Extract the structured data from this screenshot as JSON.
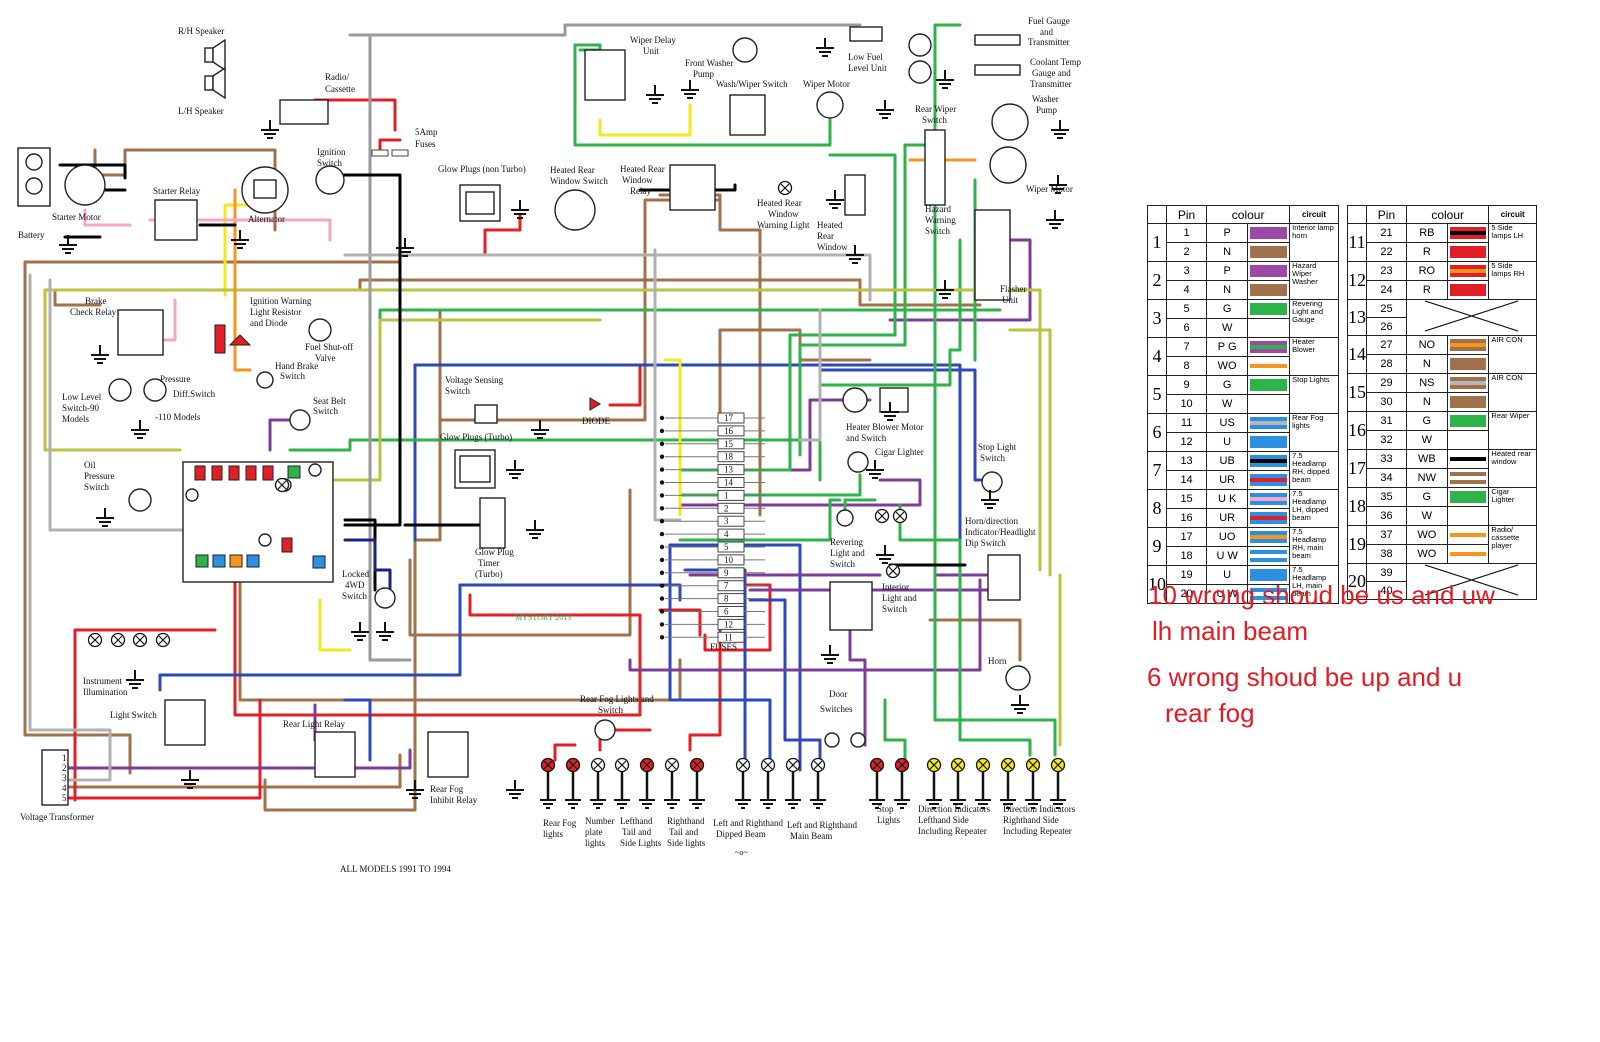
{
  "diagram": {
    "footer": "ALL MODELS 1991 TO 1994",
    "watermark": "MYSTORY 2013",
    "labels": {
      "rh_speaker": "R/H Speaker",
      "lh_speaker": "L/H Speaker",
      "radio": [
        "Radio/",
        "Cassette"
      ],
      "fuses_5a": [
        "5Amp",
        "Fuses"
      ],
      "battery": "Battery",
      "starter_motor": "Starter Motor",
      "starter_relay": "Starter Relay",
      "alternator": "Alternator",
      "ignition_switch": [
        "Ignition",
        "Switch"
      ],
      "glow_plugs_non_turbo": "Glow Plugs (non Turbo)",
      "heated_rear_window_switch": [
        "Heated Rear",
        "Window Switch"
      ],
      "heated_rear_window_relay": [
        "Heated Rear",
        "Window",
        "Relay"
      ],
      "heated_rear_window_warning": [
        "Heated Rear",
        "Window",
        "Warning Light"
      ],
      "heated_rear_window": [
        "Heated",
        "Rear",
        "Window"
      ],
      "wiper_delay_unit": [
        "Wiper Delay",
        "Unit"
      ],
      "front_washer_pump": [
        "Front Washer",
        "Pump"
      ],
      "wash_wiper_switch": "Wash/Wiper Switch",
      "wiper_motor_front": "Wiper Motor",
      "low_fuel_level_unit": [
        "Low Fuel",
        "Level Unit"
      ],
      "fuel_gauge": [
        "Fuel Gauge",
        "and",
        "Transmitter"
      ],
      "coolant_temp": [
        "Coolant Temp",
        "Gauge and",
        "Transmitter"
      ],
      "rear_wiper_switch": [
        "Rear Wiper",
        "Switch"
      ],
      "washer_pump": [
        "Washer",
        "Pump"
      ],
      "wiper_motor_rear": "Wiper Motor",
      "hazard_warning_switch": [
        "Hazard",
        "Warning",
        "Switch"
      ],
      "flasher_unit": [
        "Flasher",
        "Unit"
      ],
      "brake_check_relay": [
        "Brake",
        "Check Relay"
      ],
      "ignition_warning": [
        "Ignition Warning",
        "Light Resistor",
        "and Diode"
      ],
      "fuel_shutoff": [
        "Fuel Shut-off",
        "Valve"
      ],
      "hand_brake_switch": [
        "Hand Brake",
        "Switch"
      ],
      "seat_belt_switch": [
        "Seat Belt",
        "Switch"
      ],
      "low_level_switch": [
        "Low Level",
        "Switch-90",
        "Models"
      ],
      "pressure_diff_switch": [
        "Pressure",
        "Diff.Switch",
        "-110  Models"
      ],
      "oil_pressure_switch": [
        "Oil",
        "Pressure",
        "Switch"
      ],
      "voltage_sensing_switch": [
        "Voltage Sensing",
        "Switch"
      ],
      "diode": "DIODE",
      "glow_plugs_turbo": "Glow Plugs (Turbo)",
      "glow_plug_timer": [
        "Glow Plug",
        "Timer",
        "(Turbo)"
      ],
      "locked_4wd_switch": [
        "Locked",
        "4WD",
        "Switch"
      ],
      "heater_blower": [
        "Heater Blower Motor",
        "and Switch"
      ],
      "cigar_lighter": "Cigar Lighter",
      "stop_light_switch": [
        "Stop Light",
        "Switch"
      ],
      "horn_dip_switch": [
        "Horn/direction",
        "Indicator/Headlight",
        "Dip Switch"
      ],
      "reversing_light_switch": [
        "Revering",
        "Light and",
        "Switch"
      ],
      "interior_light": [
        "Interior",
        "Light and",
        "Switch"
      ],
      "horn": "Horn",
      "door_switches": [
        "Door",
        "Switches"
      ],
      "instrument_illumination": [
        "Instrument",
        "Illumination"
      ],
      "light_switch": "Light Switch",
      "rear_light_relay": "Rear Light Relay",
      "rear_fog_switch": [
        "Rear Fog Lights and",
        "Switch"
      ],
      "rear_fog_inhibit_relay": [
        "Rear Fog",
        "Inhibit Relay"
      ],
      "voltage_transformer": "Voltage Transformer",
      "fuses": "FUSES",
      "rear_fog_lights": [
        "Rear Fog",
        "lights"
      ],
      "number_plate_lights": [
        "Number",
        "plate",
        "lights"
      ],
      "lh_tail_side": [
        "Lefthand",
        "Tail and",
        "Side Lights"
      ],
      "rh_tail_side": [
        "Righthand",
        "Tail and",
        "Side lights"
      ],
      "dipped_beam": [
        "Left and Righthand",
        "Dipped Beam"
      ],
      "main_beam": [
        "Left and Righthand",
        "Main Beam"
      ],
      "stop_lights": [
        "Stop",
        "Lights"
      ],
      "dir_left": [
        "Direction Indicators",
        "Lefthand Side",
        "Including Repeater"
      ],
      "dir_right": [
        "Direction Indicators",
        "Righthand Side",
        "Including Repeater"
      ]
    },
    "fuse_numbers": [
      "17",
      "16",
      "15",
      "18",
      "13",
      "14",
      "1",
      "2",
      "3",
      "4",
      "5",
      "10",
      "9",
      "7",
      "8",
      "6",
      "12",
      "11"
    ],
    "transformer_pins": [
      "1",
      "2",
      "3",
      "4",
      "5"
    ]
  },
  "pin_table_1": {
    "headers": {
      "pin": "Pin",
      "colour": "colour",
      "circuit": "circuit"
    },
    "groups": [
      {
        "group": "1",
        "rows": [
          {
            "pin": "1",
            "code": "P",
            "swatch": [
              "#9b48a6"
            ]
          },
          {
            "pin": "2",
            "code": "N",
            "swatch": [
              "#a0714a"
            ]
          }
        ],
        "circuit": "Interior lamp horn"
      },
      {
        "group": "2",
        "rows": [
          {
            "pin": "3",
            "code": "P",
            "swatch": [
              "#9b48a6"
            ]
          },
          {
            "pin": "4",
            "code": "N",
            "swatch": [
              "#a0714a"
            ]
          }
        ],
        "circuit": "Hazard Wiper Washer"
      },
      {
        "group": "3",
        "rows": [
          {
            "pin": "5",
            "code": "G",
            "swatch": [
              "#2db34a"
            ]
          },
          {
            "pin": "6",
            "code": "W",
            "swatch": [
              "#ffffff"
            ]
          }
        ],
        "circuit": "Revering Light and Gauge"
      },
      {
        "group": "4",
        "rows": [
          {
            "pin": "7",
            "code": "P G",
            "swatch": [
              "#9b48a6",
              "#2db34a",
              "#9b48a6"
            ]
          },
          {
            "pin": "8",
            "code": "WO",
            "swatch": [
              "#ffffff",
              "#f7941d",
              "#ffffff"
            ]
          }
        ],
        "circuit": "Heater Blower"
      },
      {
        "group": "5",
        "rows": [
          {
            "pin": "9",
            "code": "G",
            "swatch": [
              "#2db34a"
            ]
          },
          {
            "pin": "10",
            "code": "W",
            "swatch": [
              "#ffffff"
            ]
          }
        ],
        "circuit": "Stop Lights"
      },
      {
        "group": "6",
        "rows": [
          {
            "pin": "11",
            "code": "US",
            "swatch": [
              "#2d8fe0",
              "#b7b7b7",
              "#2d8fe0"
            ]
          },
          {
            "pin": "12",
            "code": "U",
            "swatch": [
              "#2d8fe0"
            ]
          }
        ],
        "circuit": "Rear Fog lights"
      },
      {
        "group": "7",
        "rows": [
          {
            "pin": "13",
            "code": "UB",
            "swatch": [
              "#2d8fe0",
              "#000000",
              "#2d8fe0"
            ]
          },
          {
            "pin": "14",
            "code": "UR",
            "swatch": [
              "#2d8fe0",
              "#e01f26",
              "#2d8fe0"
            ]
          }
        ],
        "circuit": "7.5 Headlamp RH, dipped beam"
      },
      {
        "group": "8",
        "rows": [
          {
            "pin": "15",
            "code": "U K",
            "swatch": [
              "#2d8fe0",
              "#f4a6c4",
              "#2d8fe0"
            ]
          },
          {
            "pin": "16",
            "code": "UR",
            "swatch": [
              "#2d8fe0",
              "#e01f26",
              "#2d8fe0"
            ]
          }
        ],
        "circuit": "7.5 Headlamp LH, dipped beam"
      },
      {
        "group": "9",
        "rows": [
          {
            "pin": "17",
            "code": "UO",
            "swatch": [
              "#2d8fe0",
              "#f7941d",
              "#2d8fe0"
            ]
          },
          {
            "pin": "18",
            "code": "U W",
            "swatch": [
              "#2d8fe0",
              "#ffffff",
              "#2d8fe0"
            ]
          }
        ],
        "circuit": "7.5 Headlamp RH, main beam"
      },
      {
        "group": "10",
        "rows": [
          {
            "pin": "19",
            "code": "U",
            "swatch": [
              "#2d8fe0"
            ]
          },
          {
            "pin": "20",
            "code": "U W",
            "swatch": [
              "#2d8fe0",
              "#ffffff",
              "#2d8fe0"
            ]
          }
        ],
        "circuit": "7.5 Headlamp LH, main beam"
      }
    ]
  },
  "pin_table_2": {
    "headers": {
      "pin": "Pin",
      "colour": "colour",
      "circuit": "circuit"
    },
    "groups": [
      {
        "group": "11",
        "rows": [
          {
            "pin": "21",
            "code": "RB",
            "swatch": [
              "#e01f26",
              "#000000",
              "#e01f26"
            ]
          },
          {
            "pin": "22",
            "code": "R",
            "swatch": [
              "#e01f26"
            ]
          }
        ],
        "circuit": "5 Side lamps LH"
      },
      {
        "group": "12",
        "rows": [
          {
            "pin": "23",
            "code": "RO",
            "swatch": [
              "#e01f26",
              "#f7941d",
              "#e01f26"
            ]
          },
          {
            "pin": "24",
            "code": "R",
            "swatch": [
              "#e01f26"
            ]
          }
        ],
        "circuit": "5 Side lamps RH"
      },
      {
        "group": "13",
        "rows": [
          {
            "pin": "25",
            "code": "",
            "swatch": []
          },
          {
            "pin": "26",
            "code": "",
            "swatch": []
          }
        ],
        "circuit": "",
        "crossed": true
      },
      {
        "group": "14",
        "rows": [
          {
            "pin": "27",
            "code": "NO",
            "swatch": [
              "#a0714a",
              "#f7941d",
              "#a0714a"
            ]
          },
          {
            "pin": "28",
            "code": "N",
            "swatch": [
              "#a0714a"
            ]
          }
        ],
        "circuit": "AIR CON"
      },
      {
        "group": "15",
        "rows": [
          {
            "pin": "29",
            "code": "NS",
            "swatch": [
              "#a0714a",
              "#b7b7b7",
              "#a0714a"
            ]
          },
          {
            "pin": "30",
            "code": "N",
            "swatch": [
              "#a0714a"
            ]
          }
        ],
        "circuit": "AIR CON"
      },
      {
        "group": "16",
        "rows": [
          {
            "pin": "31",
            "code": "G",
            "swatch": [
              "#2db34a"
            ]
          },
          {
            "pin": "32",
            "code": "W",
            "swatch": [
              "#ffffff"
            ]
          }
        ],
        "circuit": "Rear Wiper"
      },
      {
        "group": "17",
        "rows": [
          {
            "pin": "33",
            "code": "WB",
            "swatch": [
              "#ffffff",
              "#000000",
              "#ffffff"
            ]
          },
          {
            "pin": "34",
            "code": "NW",
            "swatch": [
              "#a0714a",
              "#ffffff",
              "#a0714a"
            ]
          }
        ],
        "circuit": "Heated rear window"
      },
      {
        "group": "18",
        "rows": [
          {
            "pin": "35",
            "code": "G",
            "swatch": [
              "#2db34a"
            ]
          },
          {
            "pin": "36",
            "code": "W",
            "swatch": [
              "#ffffff"
            ]
          }
        ],
        "circuit": "Cigar Lighter"
      },
      {
        "group": "19",
        "rows": [
          {
            "pin": "37",
            "code": "WO",
            "swatch": [
              "#ffffff",
              "#f7941d",
              "#ffffff"
            ]
          },
          {
            "pin": "38",
            "code": "WO",
            "swatch": [
              "#ffffff",
              "#f7941d",
              "#ffffff"
            ]
          }
        ],
        "circuit": "Radio/ cassette player"
      },
      {
        "group": "20",
        "rows": [
          {
            "pin": "39",
            "code": "",
            "swatch": []
          },
          {
            "pin": "40",
            "code": "",
            "swatch": []
          }
        ],
        "circuit": "",
        "crossed": true
      }
    ]
  },
  "notes": {
    "line1": "10 wrong shoud be us and uw",
    "line2": "lh main beam",
    "line3": "6 wrong shoud be  up and u",
    "line4": "rear fog"
  }
}
